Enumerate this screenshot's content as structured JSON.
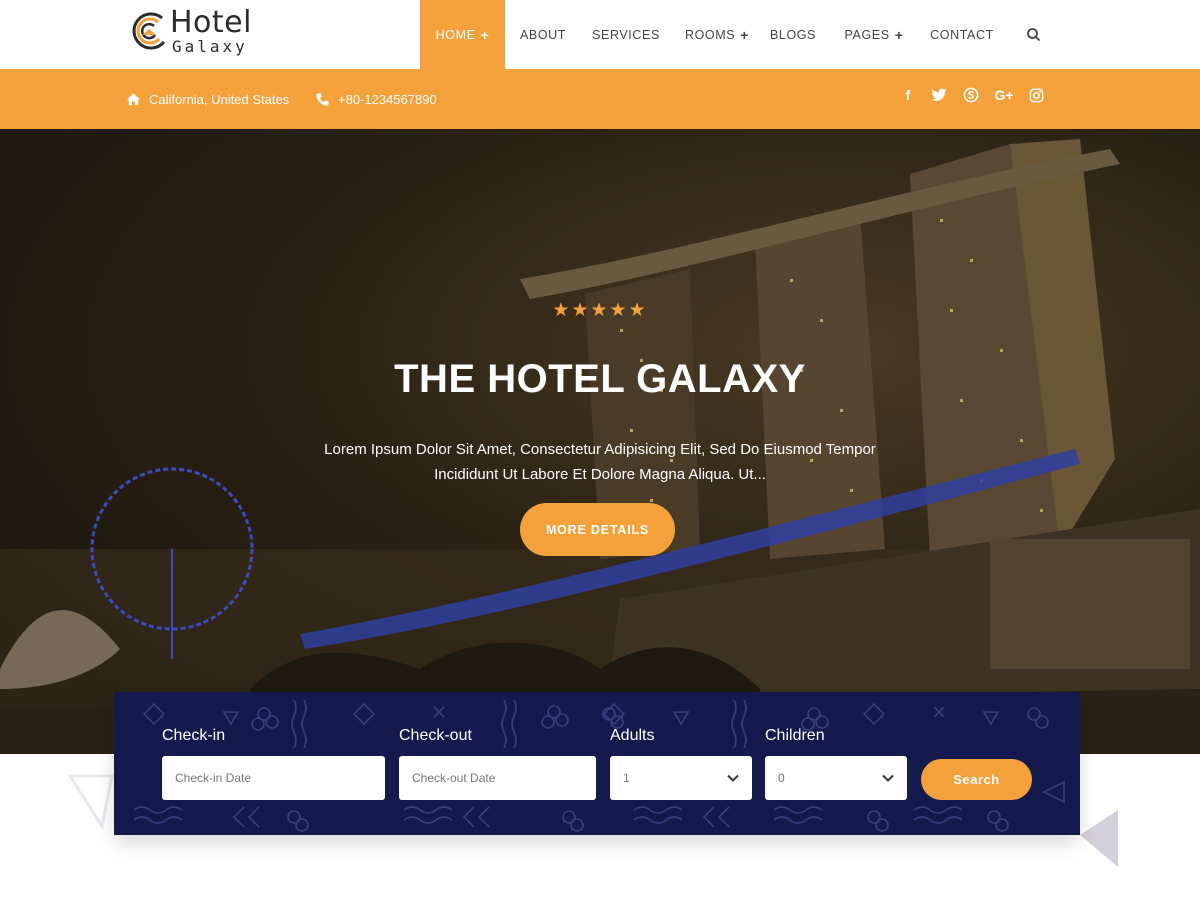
{
  "brand": {
    "title": "Hotel",
    "subtitle": "Galaxy",
    "accent": "#f4a13c",
    "dark": "#141a4e"
  },
  "nav": {
    "home": "HOME",
    "about": "ABOUT",
    "services": "SERVICES",
    "rooms": "ROOMS",
    "blogs": "BLOGS",
    "pages": "PAGES",
    "contact": "CONTACT",
    "plus": "+",
    "search_icon": "search-icon"
  },
  "topbar": {
    "location": "California, United States",
    "phone": "+80-1234567890",
    "social": {
      "facebook": "f",
      "google_plus": "G+"
    }
  },
  "hero": {
    "stars": "★★★★★",
    "rating": 5,
    "title": "THE HOTEL GALAXY",
    "text": "Lorem Ipsum Dolor Sit Amet, Consectetur Adipisicing Elit, Sed Do Eiusmod Tempor Incididunt Ut Labore Et Dolore Magna Aliqua. Ut...",
    "button": "MORE DETAILS"
  },
  "booking": {
    "checkin_label": "Check-in",
    "checkin_placeholder": "Check-in Date",
    "checkout_label": "Check-out",
    "checkout_placeholder": "Check-out Date",
    "adults_label": "Adults",
    "adults_value": "1",
    "children_label": "Children",
    "children_value": "0",
    "search_button": "Search"
  }
}
